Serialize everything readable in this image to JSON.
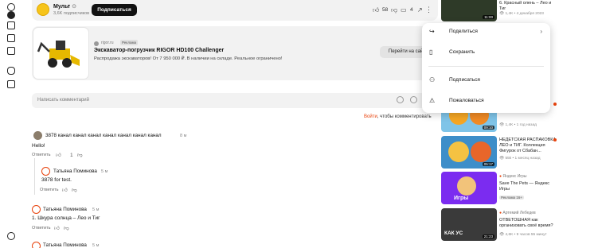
{
  "channel": {
    "name": "Мульт",
    "verified_glyph": "⊙",
    "subscribers": "3,6K подписчиков",
    "subscribe_label": "Подписаться",
    "likes": "58",
    "comments": "4"
  },
  "ad": {
    "domain": "rigor.ru",
    "badge": "Реклама",
    "title": "Экскаватор-погрузчик RIGOR HD100 Challenger",
    "text": "Распродажа экскаваторов! От 7 950 000 ₽. В наличии на складе. Реальное ограничено!",
    "cta": "Перейти на сайт"
  },
  "comment_box": {
    "placeholder": "Написать комментарий",
    "login_link": "Войти",
    "login_suffix": ", чтобы комментировать"
  },
  "comments": [
    {
      "author": "3878 канал канал канал канал канал канал канал",
      "time": "8 м",
      "text": "Hello!",
      "reply": "Ответить",
      "likes": "1"
    },
    {
      "author": "Татьяна Поминова",
      "time": "5 м",
      "text": "3878 for test.",
      "reply": "Ответить",
      "likes": ""
    },
    {
      "author": "Татьяна Поминова",
      "time": "5 м",
      "text": "1. Шкура солнца – Лео и Тиг",
      "reply": "Ответить",
      "likes": ""
    },
    {
      "author": "Татьяна Поминова",
      "time": "5 м",
      "text": "",
      "reply": "",
      "likes": ""
    }
  ],
  "menu": {
    "share": "Поделиться",
    "save": "Сохранить",
    "subscribe": "Подписаться",
    "report": "Пожаловаться"
  },
  "rail": [
    {
      "title": "6. Красный олень – Лео и Тиг",
      "meta": "1,4K • 4 декабря 2023",
      "duration": "11:00"
    },
    {
      "title": "",
      "meta": "1,4K • 1 год назад",
      "duration": "09:10"
    },
    {
      "title": "НЕДЕТСКАЯ РАСПАКОВКА ЛЕО и ТИГ. Коллекция Фигурок от Сбабан...",
      "meta": "55k • 1 месяц назад",
      "duration": "05:17"
    },
    {
      "channel": "Яндекс Игры",
      "title": "Save The Pets — Яндекс Игры",
      "badge": "Реклама 16+",
      "overlay": "Игры"
    },
    {
      "channel": "Артемий Лебедев",
      "title": "ОТВЕТОШНАЯ как организовать своё время?",
      "meta": "4,6K • 9 часов 55 минут",
      "duration": "21:23",
      "overlay": "КАК УС"
    }
  ],
  "colors": {
    "accent": "#e8420c",
    "dark_button": "#111111",
    "surface": "#f2f2f2"
  }
}
